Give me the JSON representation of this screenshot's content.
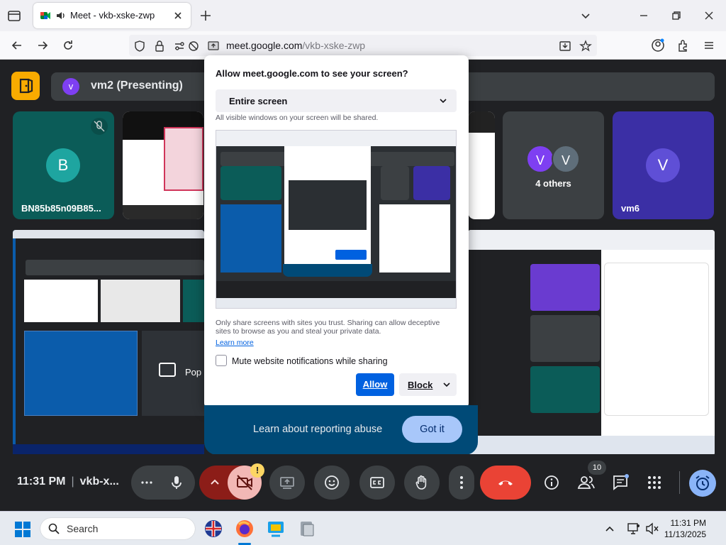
{
  "browser": {
    "tab_title": "Meet - vkb-xske-zwp",
    "url_domain": "meet.google.com",
    "url_path": "/vkb-xske-zwp"
  },
  "meet": {
    "presenting_avatar": "v",
    "presenting_label": "vm2 (Presenting)",
    "tiles": {
      "b_initial": "B",
      "b_name": "BN85b85n09B85...",
      "others_initial_1": "V",
      "others_initial_2": "V",
      "others_label": "4 others",
      "vm6_initial": "V",
      "vm6_name": "vm6"
    },
    "pop_label": "Pop"
  },
  "share_dialog": {
    "title": "Allow meet.google.com to see your screen?",
    "selected_source": "Entire screen",
    "hint": "All visible windows on your screen will be shared.",
    "warning": "Only share screens with sites you trust. Sharing can allow deceptive sites to browse as you and steal your private data.",
    "learn_more": "Learn more",
    "mute_label": "Mute website notifications while sharing",
    "allow": "Allow",
    "block": "Block"
  },
  "abuse_banner": {
    "text": "Learn about reporting abuse",
    "button": "Got it"
  },
  "controls": {
    "time": "11:31 PM",
    "meeting_code": "vkb-x...",
    "people_count": "10"
  },
  "taskbar": {
    "search_placeholder": "Search",
    "time": "11:31 PM",
    "date": "11/13/2025"
  },
  "colors": {
    "meet_bg": "#202124",
    "end_call": "#ea4335",
    "allow_blue": "#0061e0",
    "banner_blue": "#004a77"
  }
}
